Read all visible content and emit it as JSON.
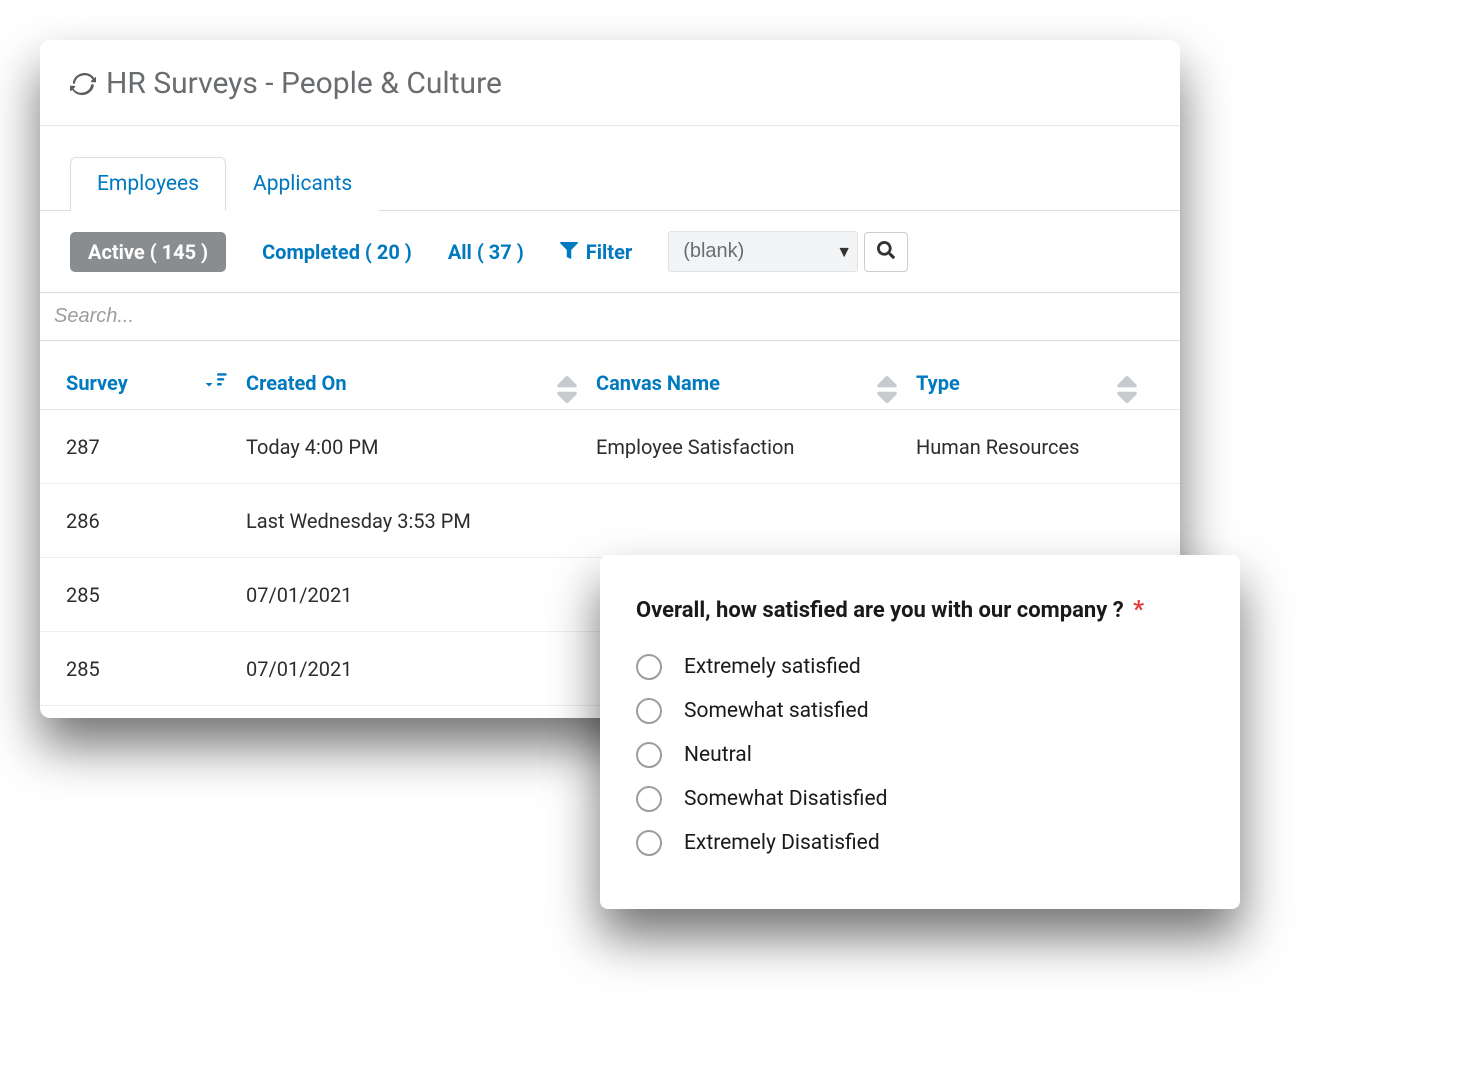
{
  "header": {
    "title": "HR Surveys - People & Culture"
  },
  "tabs": [
    {
      "label": "Employees",
      "active": true
    },
    {
      "label": "Applicants",
      "active": false
    }
  ],
  "filters": {
    "active": "Active ( 145 )",
    "completed": "Completed ( 20 )",
    "all": "All ( 37 )",
    "filter_label": "Filter",
    "select_value": "(blank)"
  },
  "search": {
    "placeholder": "Search..."
  },
  "columns": {
    "survey": "Survey",
    "created_on": "Created On",
    "canvas_name": "Canvas Name",
    "type": "Type"
  },
  "rows": [
    {
      "survey": "287",
      "created_on": "Today 4:00 PM",
      "canvas_name": "Employee Satisfaction",
      "type": "Human Resources"
    },
    {
      "survey": "286",
      "created_on": "Last Wednesday 3:53 PM",
      "canvas_name": "",
      "type": ""
    },
    {
      "survey": "285",
      "created_on": "07/01/2021",
      "canvas_name": "",
      "type": ""
    },
    {
      "survey": "285",
      "created_on": "07/01/2021",
      "canvas_name": "",
      "type": ""
    }
  ],
  "popup": {
    "question": "Overall, how satisfied are you with our company ?",
    "required_mark": "*",
    "options": [
      "Extremely satisfied",
      "Somewhat satisfied",
      "Neutral",
      "Somewhat Disatisfied",
      "Extremely Disatisfied"
    ]
  }
}
